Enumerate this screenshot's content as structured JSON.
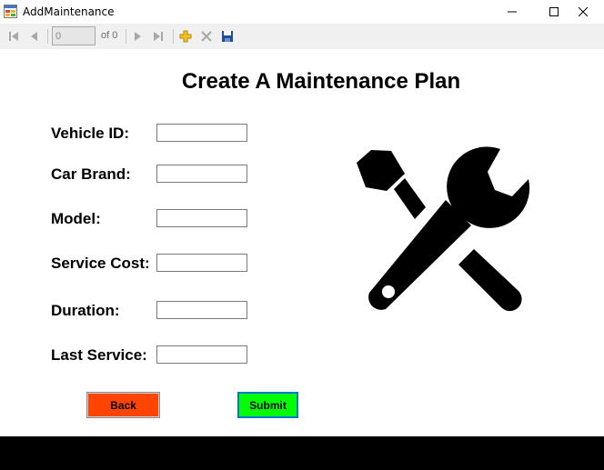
{
  "window": {
    "title": "AddMaintenance"
  },
  "toolbar": {
    "position_value": "0",
    "count_label": "of 0"
  },
  "form": {
    "heading": "Create A Maintenance Plan",
    "fields": [
      {
        "label": "Vehicle ID:",
        "value": ""
      },
      {
        "label": "Car Brand:",
        "value": ""
      },
      {
        "label": "Model:",
        "value": ""
      },
      {
        "label": "Service Cost:",
        "value": ""
      },
      {
        "label": "Duration:",
        "value": ""
      },
      {
        "label": "Last Service:",
        "value": ""
      }
    ],
    "back_label": "Back",
    "submit_label": "Submit"
  },
  "colors": {
    "back_button": "#ff4500",
    "submit_button": "#00ff00",
    "submit_border": "#0078d7",
    "bottom_bar": "#000000"
  },
  "icons": {
    "app": "form-app-icon",
    "image": "wrench-screwdriver-icon"
  }
}
